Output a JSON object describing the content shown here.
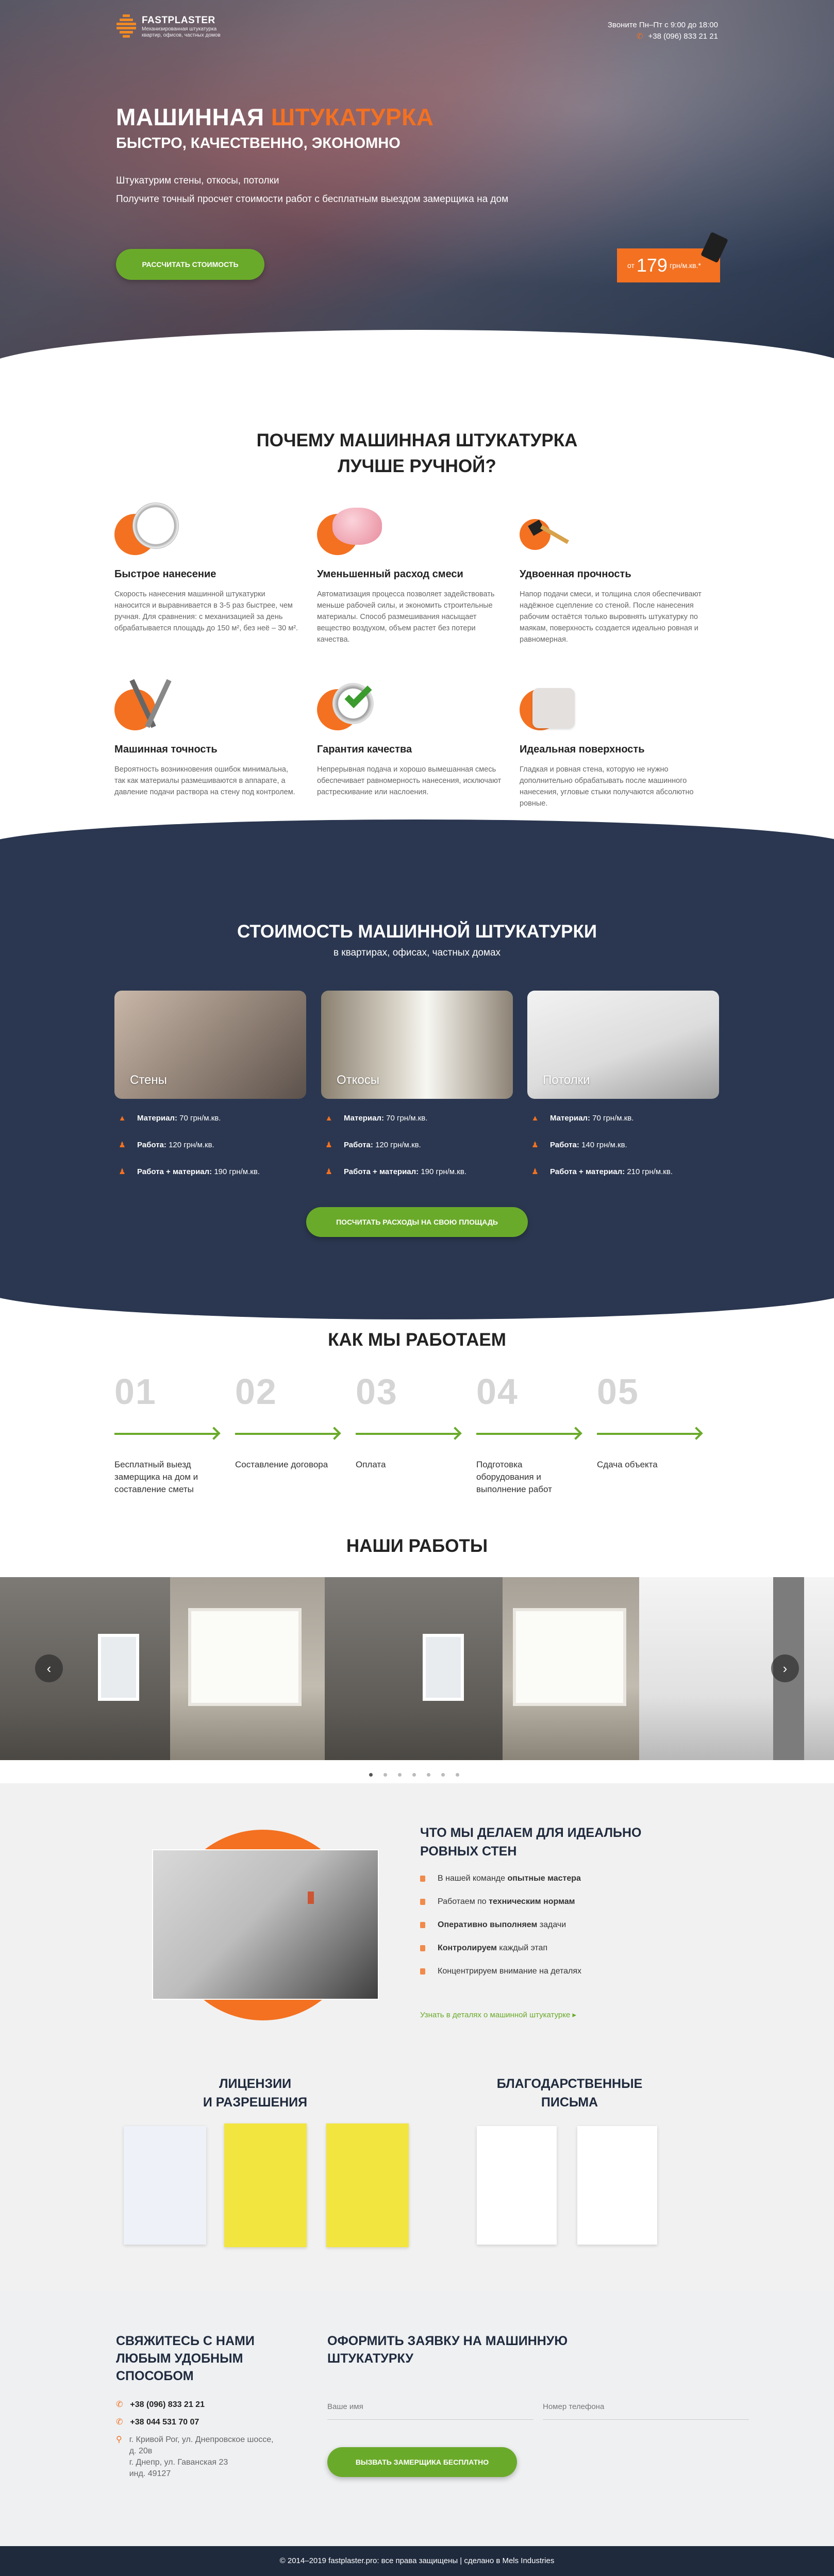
{
  "header": {
    "logo_name": "FASTPLASTER",
    "logo_sub": "Механизированная штукатурка квартир, офисов, частных домов",
    "schedule": "Звоните Пн–Пт с 9:00 до 18:00",
    "phone": "+38 (096) 833 21 21"
  },
  "hero": {
    "title_main": "МАШИННАЯ ",
    "title_accent": "ШТУКАТУРКА",
    "subtitle": "БЫСТРО, КАЧЕСТВЕННО, ЭКОНОМНО",
    "line1": "Штукатурим стены, откосы, потолки",
    "line2": "Получите точный просчет стоимости работ с бесплатным выездом замерщика на дом",
    "cta": "РАССЧИТАТЬ СТОИМОСТЬ",
    "price_from": "от",
    "price_value": "179",
    "price_unit": "грн/м.кв.*"
  },
  "why": {
    "title_line1": "ПОЧЕМУ МАШИННАЯ ШТУКАТУРКА",
    "title_line2": "ЛУЧШЕ РУЧНОЙ?",
    "features": [
      {
        "title": "Быстрое нанесение",
        "text": "Скорость нанесения машинной штукатурки наносится и выравнивается в 3-5 раз быстрее, чем ручная. Для сравнения: с механизацией за день обрабатывается площадь до 150 м², без неё – 30 м².",
        "icon": "stopwatch-icon"
      },
      {
        "title": "Уменьшенный расход смеси",
        "text": "Автоматизация процесса позволяет задействовать меньше рабочей силы, и экономить строительные материалы. Способ размешивания насыщает вещество воздухом, объем растет без потери качества.",
        "icon": "piggy-bank-icon"
      },
      {
        "title": "Удвоенная прочность",
        "text": "Напор подачи смеси, и толщина слоя обеспечивают надёжное сцепление со стеной. После нанесения рабочим остаётся только выровнять штукатурку по маякам, поверхность создается идеально ровная и равномерная.",
        "icon": "hammer-icon"
      },
      {
        "title": "Машинная точность",
        "text": "Вероятность возникновения ошибок минимальна, так как материалы размешиваются в аппарате, а давление подачи раствора на стену под контролем.",
        "icon": "compass-icon"
      },
      {
        "title": "Гарантия качества",
        "text": "Непрерывная подача и хорошо вымешанная смесь обеспечивает равномерность нанесения, исключают растрескивание или наслоения.",
        "icon": "quality-check-icon"
      },
      {
        "title": "Идеальная поверхность",
        "text": "Гладкая и ровная стена, которую не нужно дополнительно обрабатывать после машинного нанесения, угловые стыки получаются абсолютно ровные.",
        "icon": "smooth-surface-icon"
      }
    ]
  },
  "pricing": {
    "title": "СТОИМОСТЬ МАШИННОЙ ШТУКАТУРКИ",
    "subtitle": "в квартирах, офисах, частных домах",
    "cards": [
      {
        "name": "Стены",
        "material_label": "Материал:",
        "material": "70 грн/м.кв.",
        "work_label": "Работа:",
        "work": "120 грн/м.кв.",
        "total_label": "Работа + материал:",
        "total": "190 грн/м.кв."
      },
      {
        "name": "Откосы",
        "material_label": "Материал:",
        "material": "70 грн/м.кв.",
        "work_label": "Работа:",
        "work": "120 грн/м.кв.",
        "total_label": "Работа + материал:",
        "total": "190 грн/м.кв."
      },
      {
        "name": "Потолки",
        "material_label": "Материал:",
        "material": "70 грн/м.кв.",
        "work_label": "Работа:",
        "work": "140 грн/м.кв.",
        "total_label": "Работа + материал:",
        "total": "210 грн/м.кв."
      }
    ],
    "cta": "ПОСЧИТАТЬ РАСХОДЫ НА СВОЮ ПЛОЩАДЬ"
  },
  "process": {
    "title": "КАК МЫ РАБОТАЕМ",
    "steps": [
      {
        "num": "01",
        "text": "Бесплатный выезд замерщика на дом и составление сметы"
      },
      {
        "num": "02",
        "text": "Составление договора"
      },
      {
        "num": "03",
        "text": "Оплата"
      },
      {
        "num": "04",
        "text": "Подготовка оборудования и выполнение работ"
      },
      {
        "num": "05",
        "text": "Сдача объекта"
      }
    ]
  },
  "works": {
    "title": "НАШИ РАБОТЫ",
    "prev": "‹",
    "next": "›",
    "dots": 7
  },
  "ideal": {
    "title_line1": "ЧТО МЫ ДЕЛАЕМ ДЛЯ ИДЕАЛЬНО",
    "title_line2": "РОВНЫХ СТЕН",
    "items": [
      {
        "pre": "В нашей команде ",
        "bold": "опытные мастера",
        "post": ""
      },
      {
        "pre": "Работаем по ",
        "bold": "техническим нормам",
        "post": ""
      },
      {
        "pre": "",
        "bold": "Оперативно выполняем",
        "post": " задачи"
      },
      {
        "pre": "",
        "bold": "Контролируем",
        "post": " каждый этап"
      },
      {
        "pre": "Концентрируем внимание на деталях",
        "bold": "",
        "post": ""
      }
    ],
    "link": "Узнать в деталях о машинной штукатурке",
    "link_arrow": "▸"
  },
  "docs": {
    "licenses_line1": "ЛИЦЕНЗИИ",
    "licenses_line2": "И РАЗРЕШЕНИЯ",
    "letters_line1": "БЛАГОДАРСТВЕННЫЕ",
    "letters_line2": "ПИСЬМА"
  },
  "contacts": {
    "title_line1": "СВЯЖИТЕСЬ С НАМИ",
    "title_line2": "ЛЮБЫМ УДОБНЫМ",
    "title_line3": "СПОСОБОМ",
    "phone1": "+38 (096) 833 21 21",
    "phone2": "+38 044 531 70 07",
    "address1": "г. Кривой Рог, ул. Днепровское шоссе, д. 20в",
    "address2": "г. Днепр, ул. Гаванская 23",
    "address3": "инд. 49127"
  },
  "form": {
    "title_line1": "ОФОРМИТЬ ЗАЯВКУ НА МАШИННУЮ",
    "title_line2": "ШТУКАТУРКУ",
    "name_placeholder": "Ваше имя",
    "phone_placeholder": "Номер телефона",
    "submit": "ВЫЗВАТЬ ЗАМЕРЩИКА БЕСПЛАТНО"
  },
  "footer": {
    "text": "© 2014–2019 fastplaster.pro: все права защищены | сделано в Mels Industries"
  },
  "colors": {
    "accent": "#f37121",
    "green": "#6aaa2a",
    "navy": "#2b3750"
  }
}
